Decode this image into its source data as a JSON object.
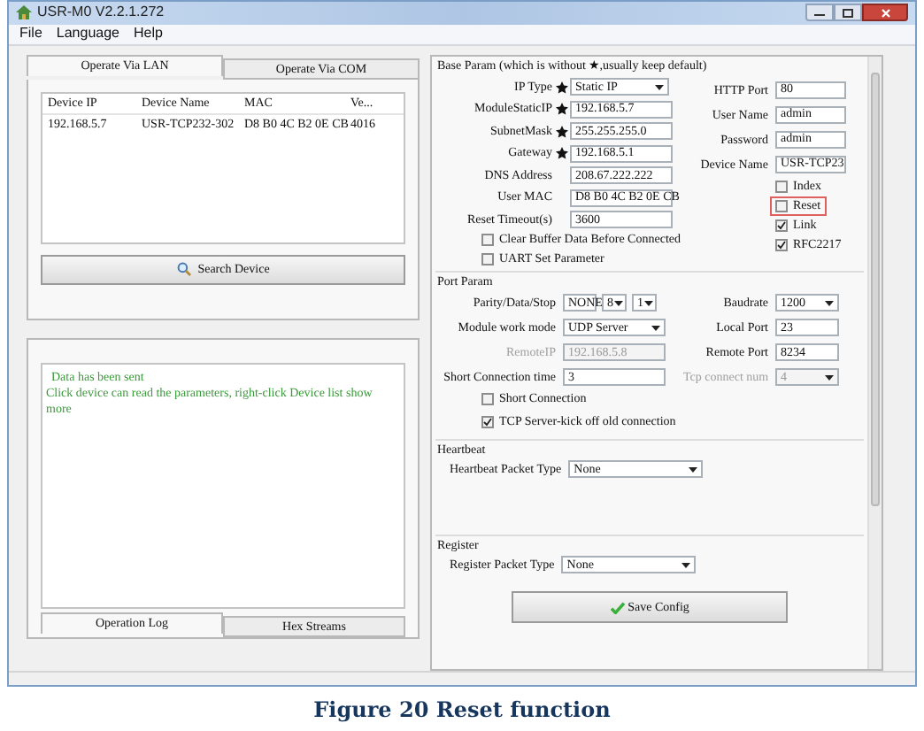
{
  "window": {
    "title": "USR-M0 V2.2.1.272"
  },
  "menu": [
    "File",
    "Language",
    "Help"
  ],
  "device_tabs": [
    {
      "label": "Operate Via LAN",
      "selected": true
    },
    {
      "label": "Operate Via COM",
      "selected": false
    }
  ],
  "device_table": {
    "columns": [
      "Device IP",
      "Device Name",
      "MAC",
      "Ve..."
    ],
    "rows": [
      [
        "192.168.5.7",
        "USR-TCP232-302",
        "D8 B0 4C B2 0E CB",
        "4016"
      ]
    ]
  },
  "search_button": "Search Device",
  "log": {
    "lines": [
      "Data has been sent",
      "Click device can read the parameters, right-click Device list show more"
    ]
  },
  "log_tabs": [
    {
      "label": "Operation Log",
      "selected": true
    },
    {
      "label": "Hex Streams",
      "selected": false
    }
  ],
  "base_param": {
    "title": "Base Param (which is without ★,usually keep default)",
    "fields": [
      {
        "label": "IP Type",
        "required": true,
        "kind": "dropdown",
        "value": "Static IP"
      },
      {
        "label": "ModuleStaticIP",
        "required": true,
        "kind": "text",
        "value": "192.168.5.7"
      },
      {
        "label": "SubnetMask",
        "required": true,
        "kind": "text",
        "value": "255.255.255.0"
      },
      {
        "label": "Gateway",
        "required": true,
        "kind": "text",
        "value": "192.168.5.1"
      },
      {
        "label": "DNS Address",
        "required": false,
        "kind": "text",
        "value": "208.67.222.222"
      },
      {
        "label": "User MAC",
        "required": false,
        "kind": "text",
        "value": "D8 B0 4C B2 0E CB"
      },
      {
        "label": "Reset Timeout(s)",
        "required": false,
        "kind": "text",
        "value": "3600"
      }
    ],
    "options": [
      {
        "label": "Clear Buffer Data Before Connected",
        "checked": false
      },
      {
        "label": "UART Set Parameter",
        "checked": false
      }
    ],
    "side_fields": [
      {
        "label": "HTTP Port",
        "value": "80"
      },
      {
        "label": "User Name",
        "value": "admin"
      },
      {
        "label": "Password",
        "value": "admin"
      },
      {
        "label": "Device Name",
        "value": "USR-TCP23"
      }
    ],
    "side_options": [
      {
        "label": "Index",
        "checked": false,
        "highlighted": false
      },
      {
        "label": "Reset",
        "checked": false,
        "highlighted": true
      },
      {
        "label": "Link",
        "checked": true,
        "highlighted": false
      },
      {
        "label": "RFC2217",
        "checked": true,
        "highlighted": false
      }
    ]
  },
  "port_param": {
    "title": "Port Param",
    "fields": [
      {
        "label": "Parity/Data/Stop",
        "kind": "dropdowns",
        "values": [
          "NONE",
          "8",
          "1"
        ],
        "disabled": false
      },
      {
        "label": "Module work mode",
        "kind": "dropdown",
        "value": "UDP Server",
        "disabled": false
      },
      {
        "label": "RemoteIP",
        "kind": "text",
        "value": "192.168.5.8",
        "disabled": true
      },
      {
        "label": "Short Connection time",
        "kind": "text",
        "value": "3",
        "disabled": false
      }
    ],
    "side_fields": [
      {
        "label": "Baudrate",
        "kind": "dropdown",
        "value": "1200",
        "disabled": false
      },
      {
        "label": "Local Port",
        "kind": "text",
        "value": "23",
        "disabled": false
      },
      {
        "label": "Remote Port",
        "kind": "text",
        "value": "8234",
        "disabled": false
      },
      {
        "label": "Tcp connect num",
        "kind": "dropdown",
        "value": "4",
        "disabled": true
      }
    ],
    "options": [
      {
        "label": "Short Connection",
        "checked": false
      },
      {
        "label": "TCP Server-kick off old connection",
        "checked": true
      }
    ]
  },
  "heartbeat": {
    "title": "Heartbeat",
    "label": "Heartbeat Packet Type",
    "value": "None"
  },
  "register": {
    "title": "Register",
    "label": "Register Packet Type",
    "value": "None"
  },
  "save_button": "Save Config",
  "caption": "Figure 20 Reset function"
}
